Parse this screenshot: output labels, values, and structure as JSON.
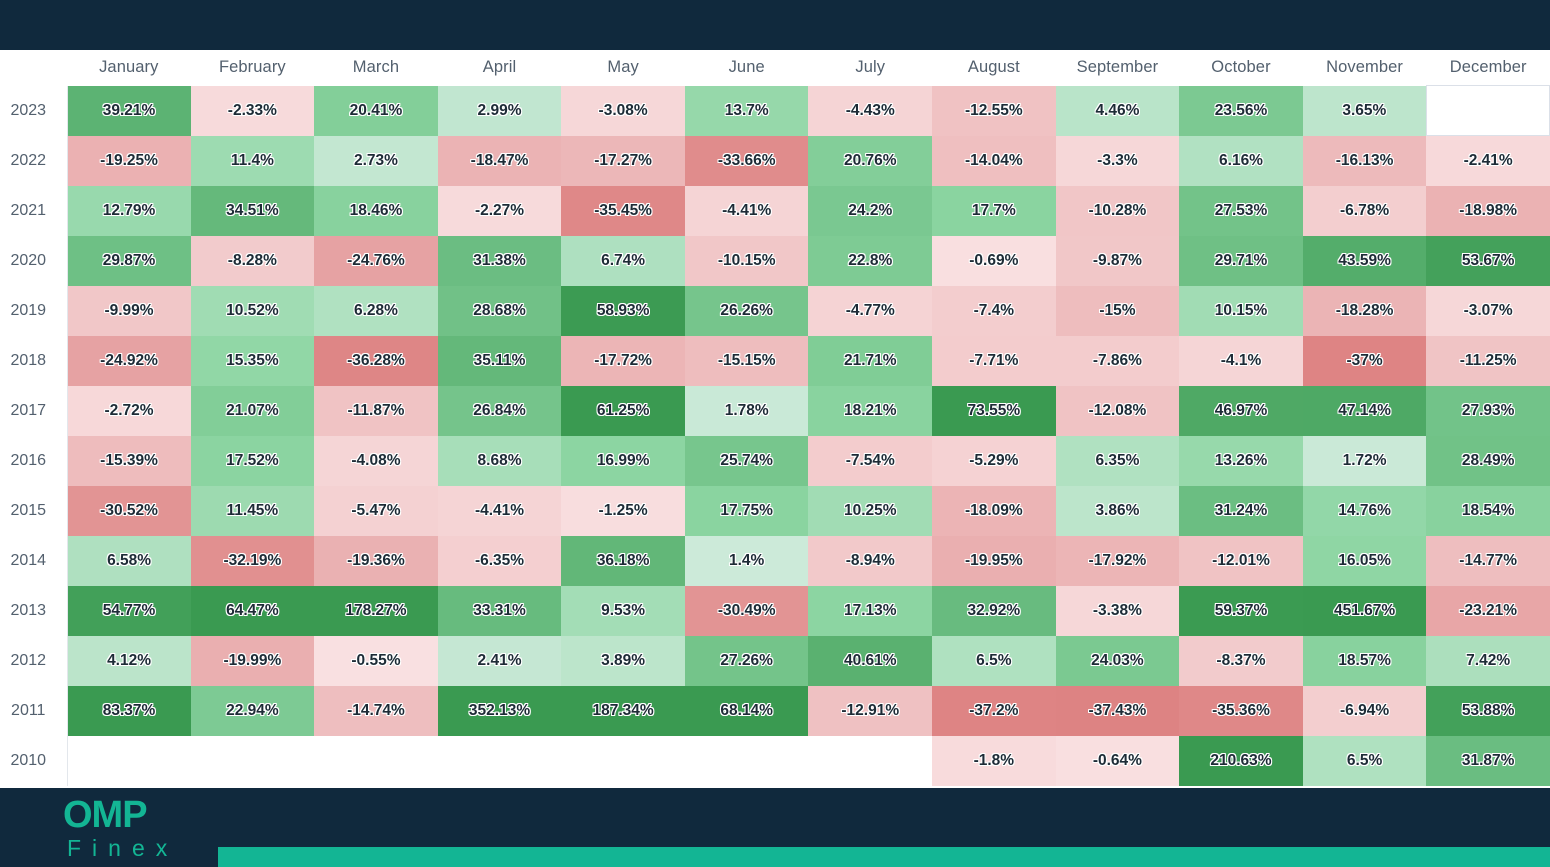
{
  "brand": {
    "logo_main": "OMP",
    "logo_sub": "Finex",
    "accent_color": "#13b594",
    "panel_background": "#10293d"
  },
  "table": {
    "year_column_header": "",
    "columns": [
      "January",
      "February",
      "March",
      "April",
      "May",
      "June",
      "July",
      "August",
      "September",
      "October",
      "November",
      "December"
    ]
  },
  "chart_data": {
    "type": "heatmap",
    "title": "",
    "xlabel": "",
    "ylabel": "",
    "x_categories": [
      "January",
      "February",
      "March",
      "April",
      "May",
      "June",
      "July",
      "August",
      "September",
      "October",
      "November",
      "December"
    ],
    "y_categories": [
      "2023",
      "2022",
      "2021",
      "2020",
      "2019",
      "2018",
      "2017",
      "2016",
      "2015",
      "2014",
      "2013",
      "2012",
      "2011",
      "2010"
    ],
    "value_suffix": "%",
    "colorscale": {
      "negative_max": "#dd8282",
      "negative_min": "#fae0e1",
      "neutral": "#ffffff",
      "positive_min": "#dcefe9",
      "positive_max": "#3a9a51"
    },
    "rows": [
      {
        "year": "2023",
        "values": [
          39.21,
          -2.33,
          20.41,
          2.99,
          -3.08,
          13.7,
          -4.43,
          -12.55,
          4.46,
          23.56,
          3.65,
          null
        ],
        "labels": [
          "39.21%",
          "-2.33%",
          "20.41%",
          "2.99%",
          "-3.08%",
          "13.7%",
          "-4.43%",
          "-12.55%",
          "4.46%",
          "23.56%",
          "3.65%",
          ""
        ]
      },
      {
        "year": "2022",
        "values": [
          -19.25,
          11.4,
          2.73,
          -18.47,
          -17.27,
          -33.66,
          20.76,
          -14.04,
          -3.3,
          6.16,
          -16.13,
          -2.41
        ],
        "labels": [
          "-19.25%",
          "11.4%",
          "2.73%",
          "-18.47%",
          "-17.27%",
          "-33.66%",
          "20.76%",
          "-14.04%",
          "-3.3%",
          "6.16%",
          "-16.13%",
          "-2.41%"
        ]
      },
      {
        "year": "2021",
        "values": [
          12.79,
          34.51,
          18.46,
          -2.27,
          -35.45,
          -4.41,
          24.2,
          17.7,
          -10.28,
          27.53,
          -6.78,
          -18.98
        ],
        "labels": [
          "12.79%",
          "34.51%",
          "18.46%",
          "-2.27%",
          "-35.45%",
          "-4.41%",
          "24.2%",
          "17.7%",
          "-10.28%",
          "27.53%",
          "-6.78%",
          "-18.98%"
        ]
      },
      {
        "year": "2020",
        "values": [
          29.87,
          -8.28,
          -24.76,
          31.38,
          6.74,
          -10.15,
          22.8,
          -0.69,
          -9.87,
          29.71,
          43.59,
          53.67
        ],
        "labels": [
          "29.87%",
          "-8.28%",
          "-24.76%",
          "31.38%",
          "6.74%",
          "-10.15%",
          "22.8%",
          "-0.69%",
          "-9.87%",
          "29.71%",
          "43.59%",
          "53.67%"
        ]
      },
      {
        "year": "2019",
        "values": [
          -9.99,
          10.52,
          6.28,
          28.68,
          58.93,
          26.26,
          -4.77,
          -7.4,
          -15,
          10.15,
          -18.28,
          -3.07
        ],
        "labels": [
          "-9.99%",
          "10.52%",
          "6.28%",
          "28.68%",
          "58.93%",
          "26.26%",
          "-4.77%",
          "-7.4%",
          "-15%",
          "10.15%",
          "-18.28%",
          "-3.07%"
        ]
      },
      {
        "year": "2018",
        "values": [
          -24.92,
          15.35,
          -36.28,
          35.11,
          -17.72,
          -15.15,
          21.71,
          -7.71,
          -7.86,
          -4.1,
          -37,
          -11.25
        ],
        "labels": [
          "-24.92%",
          "15.35%",
          "-36.28%",
          "35.11%",
          "-17.72%",
          "-15.15%",
          "21.71%",
          "-7.71%",
          "-7.86%",
          "-4.1%",
          "-37%",
          "-11.25%"
        ]
      },
      {
        "year": "2017",
        "values": [
          -2.72,
          21.07,
          -11.87,
          26.84,
          61.25,
          1.78,
          18.21,
          73.55,
          -12.08,
          46.97,
          47.14,
          27.93
        ],
        "labels": [
          "-2.72%",
          "21.07%",
          "-11.87%",
          "26.84%",
          "61.25%",
          "1.78%",
          "18.21%",
          "73.55%",
          "-12.08%",
          "46.97%",
          "47.14%",
          "27.93%"
        ]
      },
      {
        "year": "2016",
        "values": [
          -15.39,
          17.52,
          -4.08,
          8.68,
          16.99,
          25.74,
          -7.54,
          -5.29,
          6.35,
          13.26,
          1.72,
          28.49
        ],
        "labels": [
          "-15.39%",
          "17.52%",
          "-4.08%",
          "8.68%",
          "16.99%",
          "25.74%",
          "-7.54%",
          "-5.29%",
          "6.35%",
          "13.26%",
          "1.72%",
          "28.49%"
        ]
      },
      {
        "year": "2015",
        "values": [
          -30.52,
          11.45,
          -5.47,
          -4.41,
          -1.25,
          17.75,
          10.25,
          -18.09,
          3.86,
          31.24,
          14.76,
          18.54
        ],
        "labels": [
          "-30.52%",
          "11.45%",
          "-5.47%",
          "-4.41%",
          "-1.25%",
          "17.75%",
          "10.25%",
          "-18.09%",
          "3.86%",
          "31.24%",
          "14.76%",
          "18.54%"
        ]
      },
      {
        "year": "2014",
        "values": [
          6.58,
          -32.19,
          -19.36,
          -6.35,
          36.18,
          1.4,
          -8.94,
          -19.95,
          -17.92,
          -12.01,
          16.05,
          -14.77
        ],
        "labels": [
          "6.58%",
          "-32.19%",
          "-19.36%",
          "-6.35%",
          "36.18%",
          "1.4%",
          "-8.94%",
          "-19.95%",
          "-17.92%",
          "-12.01%",
          "16.05%",
          "-14.77%"
        ]
      },
      {
        "year": "2013",
        "values": [
          54.77,
          64.47,
          178.27,
          33.31,
          9.53,
          -30.49,
          17.13,
          32.92,
          -3.38,
          59.37,
          451.67,
          -23.21
        ],
        "labels": [
          "54.77%",
          "64.47%",
          "178.27%",
          "33.31%",
          "9.53%",
          "-30.49%",
          "17.13%",
          "32.92%",
          "-3.38%",
          "59.37%",
          "451.67%",
          "-23.21%"
        ]
      },
      {
        "year": "2012",
        "values": [
          4.12,
          -19.99,
          -0.55,
          2.41,
          3.89,
          27.26,
          40.61,
          6.5,
          24.03,
          -8.37,
          18.57,
          7.42
        ],
        "labels": [
          "4.12%",
          "-19.99%",
          "-0.55%",
          "2.41%",
          "3.89%",
          "27.26%",
          "40.61%",
          "6.5%",
          "24.03%",
          "-8.37%",
          "18.57%",
          "7.42%"
        ]
      },
      {
        "year": "2011",
        "values": [
          83.37,
          22.94,
          -14.74,
          352.13,
          187.34,
          68.14,
          -12.91,
          -37.2,
          -37.43,
          -35.36,
          -6.94,
          53.88
        ],
        "labels": [
          "83.37%",
          "22.94%",
          "-14.74%",
          "352.13%",
          "187.34%",
          "68.14%",
          "-12.91%",
          "-37.2%",
          "-37.43%",
          "-35.36%",
          "-6.94%",
          "53.88%"
        ]
      },
      {
        "year": "2010",
        "values": [
          null,
          null,
          null,
          null,
          null,
          null,
          null,
          -1.8,
          -0.64,
          210.63,
          6.5,
          31.87
        ],
        "labels": [
          "",
          "",
          "",
          "",
          "",
          "",
          "",
          "-1.8%",
          "-0.64%",
          "210.63%",
          "6.5%",
          "31.87%"
        ]
      }
    ]
  }
}
